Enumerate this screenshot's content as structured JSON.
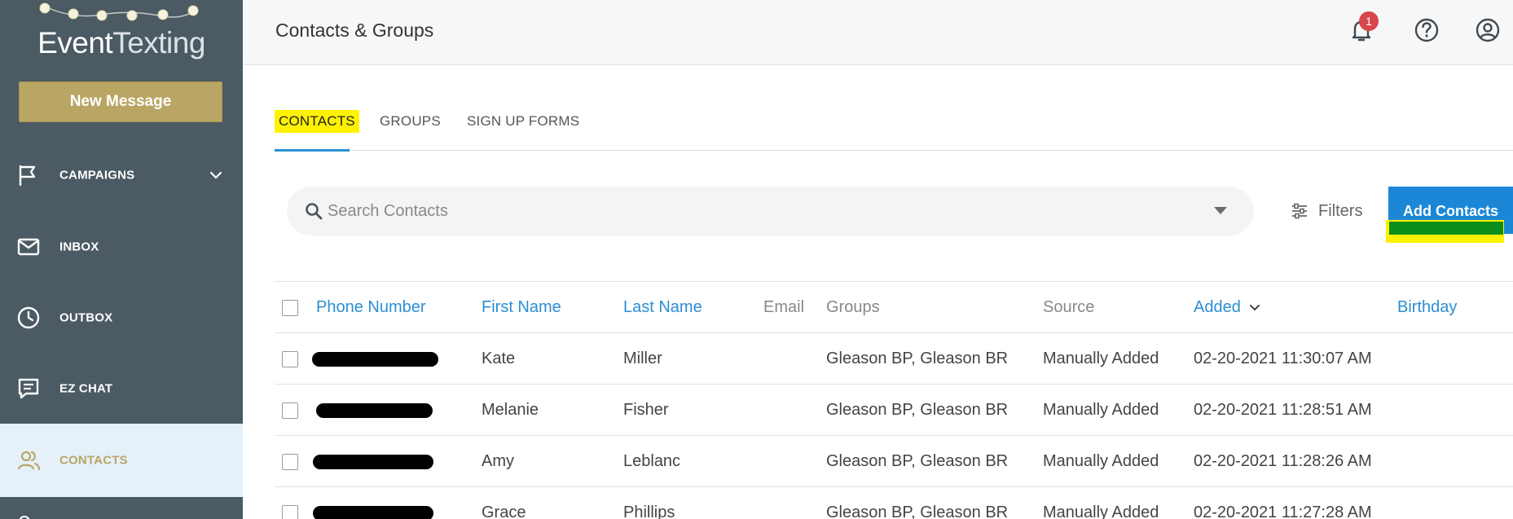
{
  "app": {
    "logo": {
      "part1": "Event",
      "part2": "Texting"
    },
    "new_message_label": "New Message"
  },
  "sidebar": {
    "items": [
      {
        "label": "CAMPAIGNS",
        "icon": "flag-icon"
      },
      {
        "label": "INBOX",
        "icon": "envelope-icon"
      },
      {
        "label": "OUTBOX",
        "icon": "clock-icon"
      },
      {
        "label": "EZ CHAT",
        "icon": "chat-icon"
      },
      {
        "label": "CONTACTS",
        "icon": "users-icon",
        "active": true
      }
    ]
  },
  "header": {
    "title": "Contacts & Groups",
    "notification_count": "1",
    "icons": [
      "bell-icon",
      "help-icon",
      "user-icon"
    ]
  },
  "tabs": [
    {
      "label": "CONTACTS",
      "active": true
    },
    {
      "label": "GROUPS"
    },
    {
      "label": "SIGN UP FORMS"
    }
  ],
  "search": {
    "placeholder": "Search Contacts",
    "value": ""
  },
  "filters_label": "Filters",
  "add_contacts_label": "Add Contacts",
  "table": {
    "columns": [
      "Phone Number",
      "First Name",
      "Last Name",
      "Email",
      "Groups",
      "Source",
      "Added",
      "Birthday"
    ],
    "rows": [
      {
        "phone": "",
        "first": "Kate",
        "last": "Miller",
        "email": "",
        "groups": "Gleason BP, Gleason BR",
        "source": "Manually Added",
        "added": "02-20-2021 11:30:07 AM",
        "birthday": ""
      },
      {
        "phone": "",
        "first": "Melanie",
        "last": "Fisher",
        "email": "",
        "groups": "Gleason BP, Gleason BR",
        "source": "Manually Added",
        "added": "02-20-2021 11:28:51 AM",
        "birthday": ""
      },
      {
        "phone": "",
        "first": "Amy",
        "last": "Leblanc",
        "email": "",
        "groups": "Gleason BP, Gleason BR",
        "source": "Manually Added",
        "added": "02-20-2021 11:28:26 AM",
        "birthday": ""
      },
      {
        "phone": "",
        "first": "Grace",
        "last": "Phillips",
        "email": "",
        "groups": "Gleason BP, Gleason BR",
        "source": "Manually Added",
        "added": "02-20-2021 11:27:28 AM",
        "birthday": ""
      }
    ]
  },
  "colors": {
    "sidebar": "#4b5a63",
    "gold": "#b9a665",
    "accent_blue": "#1b87d6",
    "highlight_yellow": "#fff200",
    "highlight_green": "#0c8e1c",
    "badge_red": "#d8454a"
  }
}
